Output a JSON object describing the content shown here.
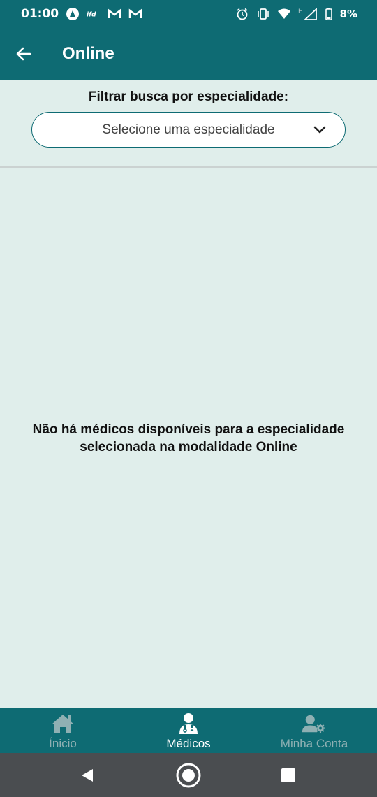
{
  "status_bar": {
    "time": "01:00",
    "battery": "8%",
    "network_label": "H"
  },
  "app_bar": {
    "title": "Online"
  },
  "filter": {
    "label": "Filtrar busca por especialidade:",
    "select_value": "Selecione uma especialidade"
  },
  "empty_state": {
    "line1": "Não há médicos disponíveis para a especialidade",
    "line2": "selecionada na modalidade Online"
  },
  "bottom_nav": {
    "items": [
      {
        "label": "Ínicio",
        "icon": "home-icon",
        "active": false
      },
      {
        "label": "Médicos",
        "icon": "doctor-icon",
        "active": true
      },
      {
        "label": "Minha Conta",
        "icon": "user-settings-icon",
        "active": false
      }
    ]
  },
  "colors": {
    "primary": "#0E6B73",
    "background": "#E0EEEB",
    "nav_inactive": "#8FB0B3",
    "system_nav": "#4A4D50"
  }
}
